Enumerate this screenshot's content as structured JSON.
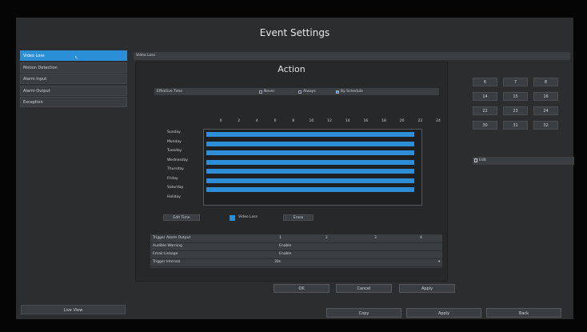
{
  "window": {
    "title": "Event Settings"
  },
  "sidebar": {
    "items": [
      {
        "label": "Video Loss",
        "active": true
      },
      {
        "label": "Motion Detection",
        "active": false
      },
      {
        "label": "Alarm Input",
        "active": false
      },
      {
        "label": "Alarm Output",
        "active": false
      },
      {
        "label": "Exception",
        "active": false
      }
    ],
    "live_view": "Live View"
  },
  "main": {
    "header": "Video Loss",
    "action_title": "Action",
    "effective_time": {
      "label": "Effective Time",
      "options": [
        {
          "label": "Never",
          "checked": false
        },
        {
          "label": "Always",
          "checked": false
        },
        {
          "label": "By Schedule",
          "checked": true
        }
      ]
    },
    "hours": [
      "0",
      "2",
      "4",
      "6",
      "8",
      "10",
      "12",
      "14",
      "16",
      "18",
      "20",
      "22",
      "24"
    ],
    "days": [
      "Sunday",
      "Monday",
      "Tuesday",
      "Wednesday",
      "Thursday",
      "Friday",
      "Saturday",
      "Holiday"
    ],
    "schedule_fill": [
      1,
      1,
      1,
      1,
      1,
      1,
      1,
      0
    ],
    "edit_time": "Edit Time",
    "legend": "Video Loss",
    "erase": "Erase",
    "trigger": {
      "rows": [
        {
          "label": "Trigger Alarm Output",
          "cols": [
            "1",
            "2",
            "3",
            "4"
          ]
        },
        {
          "label": "Audible Warning",
          "value": "Enable"
        },
        {
          "label": "Email Linkage",
          "value": "Enable"
        },
        {
          "label": "Trigger Interval",
          "value": "30s"
        }
      ]
    },
    "ok": "OK",
    "cancel": "Cancel",
    "apply": "Apply"
  },
  "channels": [
    "6",
    "7",
    "8",
    "14",
    "15",
    "16",
    "22",
    "23",
    "24",
    "30",
    "31",
    "32"
  ],
  "edit_label": "Edit",
  "footer": {
    "copy": "Copy",
    "apply": "Apply",
    "back": "Back"
  },
  "colors": {
    "accent": "#2b8fd8",
    "bg": "#2b2d2f"
  }
}
